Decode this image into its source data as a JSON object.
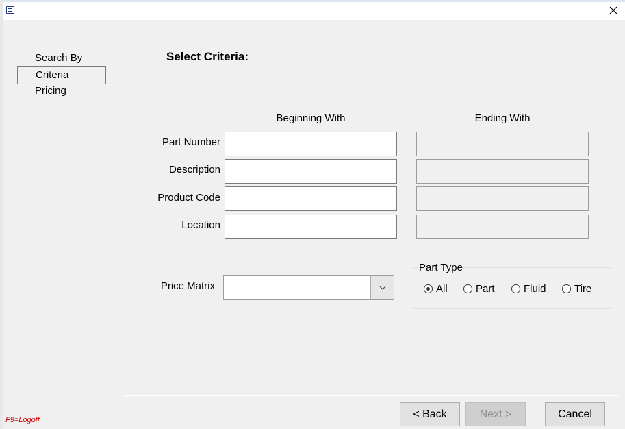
{
  "window": {
    "title": "",
    "icon": "app-window-icon",
    "close_icon": "close-icon"
  },
  "nav": {
    "heading": "Search By",
    "items": [
      {
        "label": "Criteria",
        "selected": true
      },
      {
        "label": "Pricing",
        "selected": false
      }
    ]
  },
  "main": {
    "title": "Select Criteria:",
    "columns": {
      "begin": "Beginning With",
      "end": "Ending With"
    },
    "rows": [
      {
        "label": "Part Number",
        "begin_value": "",
        "end_value": ""
      },
      {
        "label": "Description",
        "begin_value": "",
        "end_value": ""
      },
      {
        "label": "Product Code",
        "begin_value": "",
        "end_value": ""
      },
      {
        "label": "Location",
        "begin_value": "",
        "end_value": ""
      }
    ],
    "price_matrix": {
      "label": "Price Matrix",
      "value": ""
    },
    "part_type": {
      "label": "Part Type",
      "options": [
        "All",
        "Part",
        "Fluid",
        "Tire"
      ],
      "selected": "All"
    }
  },
  "buttons": {
    "back": "< Back",
    "next": "Next >",
    "cancel": "Cancel"
  },
  "footer": {
    "hint": "F9=Logoff"
  },
  "colors": {
    "hint": "#d00000",
    "dialog_bg": "#f0f0f0"
  }
}
